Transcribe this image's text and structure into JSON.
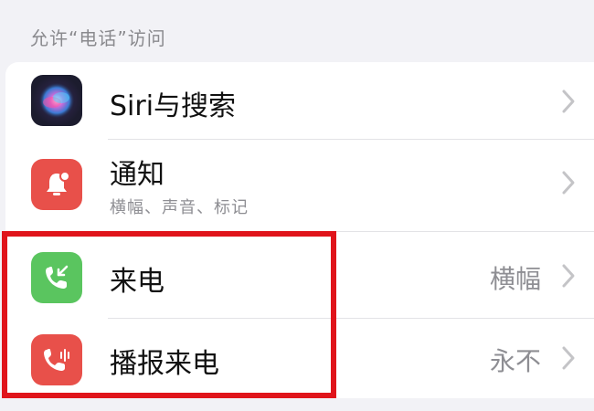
{
  "section": {
    "header": "允许“电话”访问"
  },
  "rows": [
    {
      "label": "Siri与搜索",
      "icon": "siri-icon",
      "value": ""
    },
    {
      "label": "通知",
      "sublabel": "横幅、声音、标记",
      "icon": "notification-bell-icon",
      "value": ""
    },
    {
      "label": "来电",
      "icon": "incoming-call-icon",
      "value": "横幅"
    },
    {
      "label": "播报来电",
      "icon": "announce-call-icon",
      "value": "永不"
    }
  ],
  "colors": {
    "background": "#f2f2f6",
    "siri_icon": "#1c1c2e",
    "notification_icon": "#e8504a",
    "incoming_call_icon": "#5ac55f",
    "announce_call_icon": "#e8504a",
    "highlight_border": "#e0141b"
  }
}
